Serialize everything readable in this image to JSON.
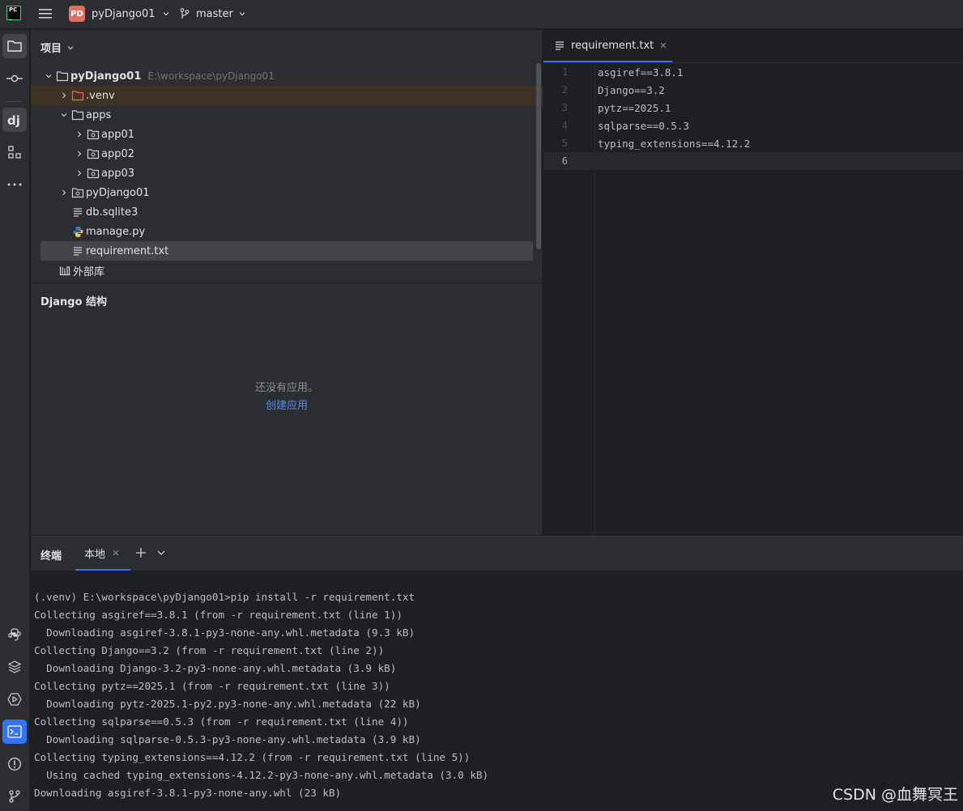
{
  "titlebar": {
    "logo_top": "PC",
    "logo_bottom": "_",
    "project_badge": "PD",
    "project_name": "pyDjango01",
    "branch_name": "master"
  },
  "project_panel": {
    "title": "项目",
    "tree": [
      {
        "label": "pyDjango01",
        "path": "E:\\workspace\\pyDjango01"
      },
      {
        "label": ".venv"
      },
      {
        "label": "apps"
      },
      {
        "label": "app01"
      },
      {
        "label": "app02"
      },
      {
        "label": "app03"
      },
      {
        "label": "pyDjango01"
      },
      {
        "label": "db.sqlite3"
      },
      {
        "label": "manage.py"
      },
      {
        "label": "requirement.txt"
      },
      {
        "label": "外部库"
      }
    ]
  },
  "django_panel": {
    "title": "Django 结构",
    "empty_message": "还没有应用。",
    "create_link": "创建应用"
  },
  "editor": {
    "tab_label": "requirement.txt",
    "lines": [
      {
        "num": "1",
        "text": "asgiref==3.8.1"
      },
      {
        "num": "2",
        "text": "Django==3.2"
      },
      {
        "num": "3",
        "text": "pytz==2025.1"
      },
      {
        "num": "4",
        "text": "sqlparse==0.5.3"
      },
      {
        "num": "5",
        "text": "typing_extensions==4.12.2"
      },
      {
        "num": "6",
        "text": ""
      }
    ]
  },
  "terminal": {
    "title": "终端",
    "tab_label": "本地",
    "output": [
      "(.venv) E:\\workspace\\pyDjango01>pip install -r requirement.txt",
      "Collecting asgiref==3.8.1 (from -r requirement.txt (line 1))",
      "  Downloading asgiref-3.8.1-py3-none-any.whl.metadata (9.3 kB)",
      "Collecting Django==3.2 (from -r requirement.txt (line 2))",
      "  Downloading Django-3.2-py3-none-any.whl.metadata (3.9 kB)",
      "Collecting pytz==2025.1 (from -r requirement.txt (line 3))",
      "  Downloading pytz-2025.1-py2.py3-none-any.whl.metadata (22 kB)",
      "Collecting sqlparse==0.5.3 (from -r requirement.txt (line 4))",
      "  Downloading sqlparse-0.5.3-py3-none-any.whl.metadata (3.9 kB)",
      "Collecting typing_extensions==4.12.2 (from -r requirement.txt (line 5))",
      "  Using cached typing_extensions-4.12.2-py3-none-any.whl.metadata (3.0 kB)",
      "Downloading asgiref-3.8.1-py3-none-any.whl (23 kB)"
    ]
  },
  "watermark": "CSDN @血舞冥王",
  "colors": {
    "accent": "#3574f0",
    "link": "#548af7",
    "venv_folder": "#e0705f"
  }
}
